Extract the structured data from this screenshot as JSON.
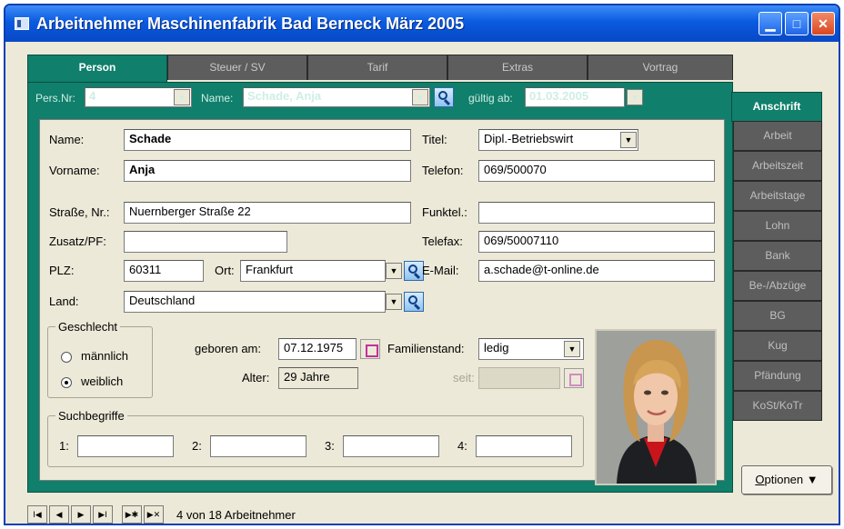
{
  "window": {
    "title": "Arbeitnehmer Maschinenfabrik Bad Berneck März 2005",
    "min_glyph": "▁",
    "max_glyph": "□",
    "close_glyph": "✕"
  },
  "tabs": [
    {
      "label": "Person",
      "active": true
    },
    {
      "label": "Steuer / SV",
      "active": false
    },
    {
      "label": "Tarif",
      "active": false
    },
    {
      "label": "Extras",
      "active": false
    },
    {
      "label": "Vortrag",
      "active": false
    }
  ],
  "toprow": {
    "persnr_label": "Pers.Nr:",
    "persnr_value": "4",
    "name_label": "Name:",
    "name_value": "Schade, Anja",
    "gueltig_label": "gültig ab:",
    "gueltig_value": "01.03.2005"
  },
  "person": {
    "name_label": "Name:",
    "name_value": "Schade",
    "vorname_label": "Vorname:",
    "vorname_value": "Anja",
    "strasse_label": "Straße, Nr.:",
    "strasse_value": "Nuernberger Straße 22",
    "zusatz_label": "Zusatz/PF:",
    "zusatz_value": "",
    "plz_label": "PLZ:",
    "plz_value": "60311",
    "ort_label": "Ort:",
    "ort_value": "Frankfurt",
    "land_label": "Land:",
    "land_value": "Deutschland",
    "titel_label": "Titel:",
    "titel_value": "Dipl.-Betriebswirt",
    "telefon_label": "Telefon:",
    "telefon_value": "069/500070",
    "funktel_label": "Funktel.:",
    "funktel_value": "",
    "telefax_label": "Telefax:",
    "telefax_value": "069/50007110",
    "email_label": "E-Mail:",
    "email_value": "a.schade@t-online.de"
  },
  "geschlecht": {
    "legend": "Geschlecht",
    "maennlich": "männlich",
    "weiblich": "weiblich",
    "selected": "weiblich"
  },
  "birth": {
    "geboren_label": "geboren am:",
    "geboren_value": "07.12.1975",
    "alter_label": "Alter:",
    "alter_value": "29 Jahre",
    "familienstand_label": "Familienstand:",
    "familienstand_value": "ledig",
    "seit_label": "seit:",
    "seit_value": ""
  },
  "suchbegriffe": {
    "legend": "Suchbegriffe",
    "items": [
      {
        "label": "1:",
        "value": ""
      },
      {
        "label": "2:",
        "value": ""
      },
      {
        "label": "3:",
        "value": ""
      },
      {
        "label": "4:",
        "value": ""
      }
    ]
  },
  "sidetabs": [
    {
      "label": "Anschrift",
      "active": true
    },
    {
      "label": "Arbeit",
      "active": false
    },
    {
      "label": "Arbeitszeit",
      "active": false
    },
    {
      "label": "Arbeitstage",
      "active": false
    },
    {
      "label": "Lohn",
      "active": false
    },
    {
      "label": "Bank",
      "active": false
    },
    {
      "label": "Be-/Abzüge",
      "active": false
    },
    {
      "label": "BG",
      "active": false
    },
    {
      "label": "Kug",
      "active": false
    },
    {
      "label": "Pfändung",
      "active": false
    },
    {
      "label": "KoSt/KoTr",
      "active": false
    }
  ],
  "options_button": {
    "label_u": "O",
    "label_rest": "ptionen",
    "arrow": "▼"
  },
  "navigation": {
    "first": "I◀",
    "prev": "◀",
    "next": "▶",
    "last": "▶I",
    "new": "▶✱",
    "delete": "▶✕",
    "status": "4 von 18 Arbeitnehmer"
  },
  "colors": {
    "accent_teal": "#107f6b",
    "tab_inactive": "#5d5d5d",
    "titlebar_blue": "#0a5ae0"
  },
  "icons": {
    "search": "magnifier-icon",
    "calendar": "calendar-icon",
    "dropdown": "chevron-down-icon"
  }
}
